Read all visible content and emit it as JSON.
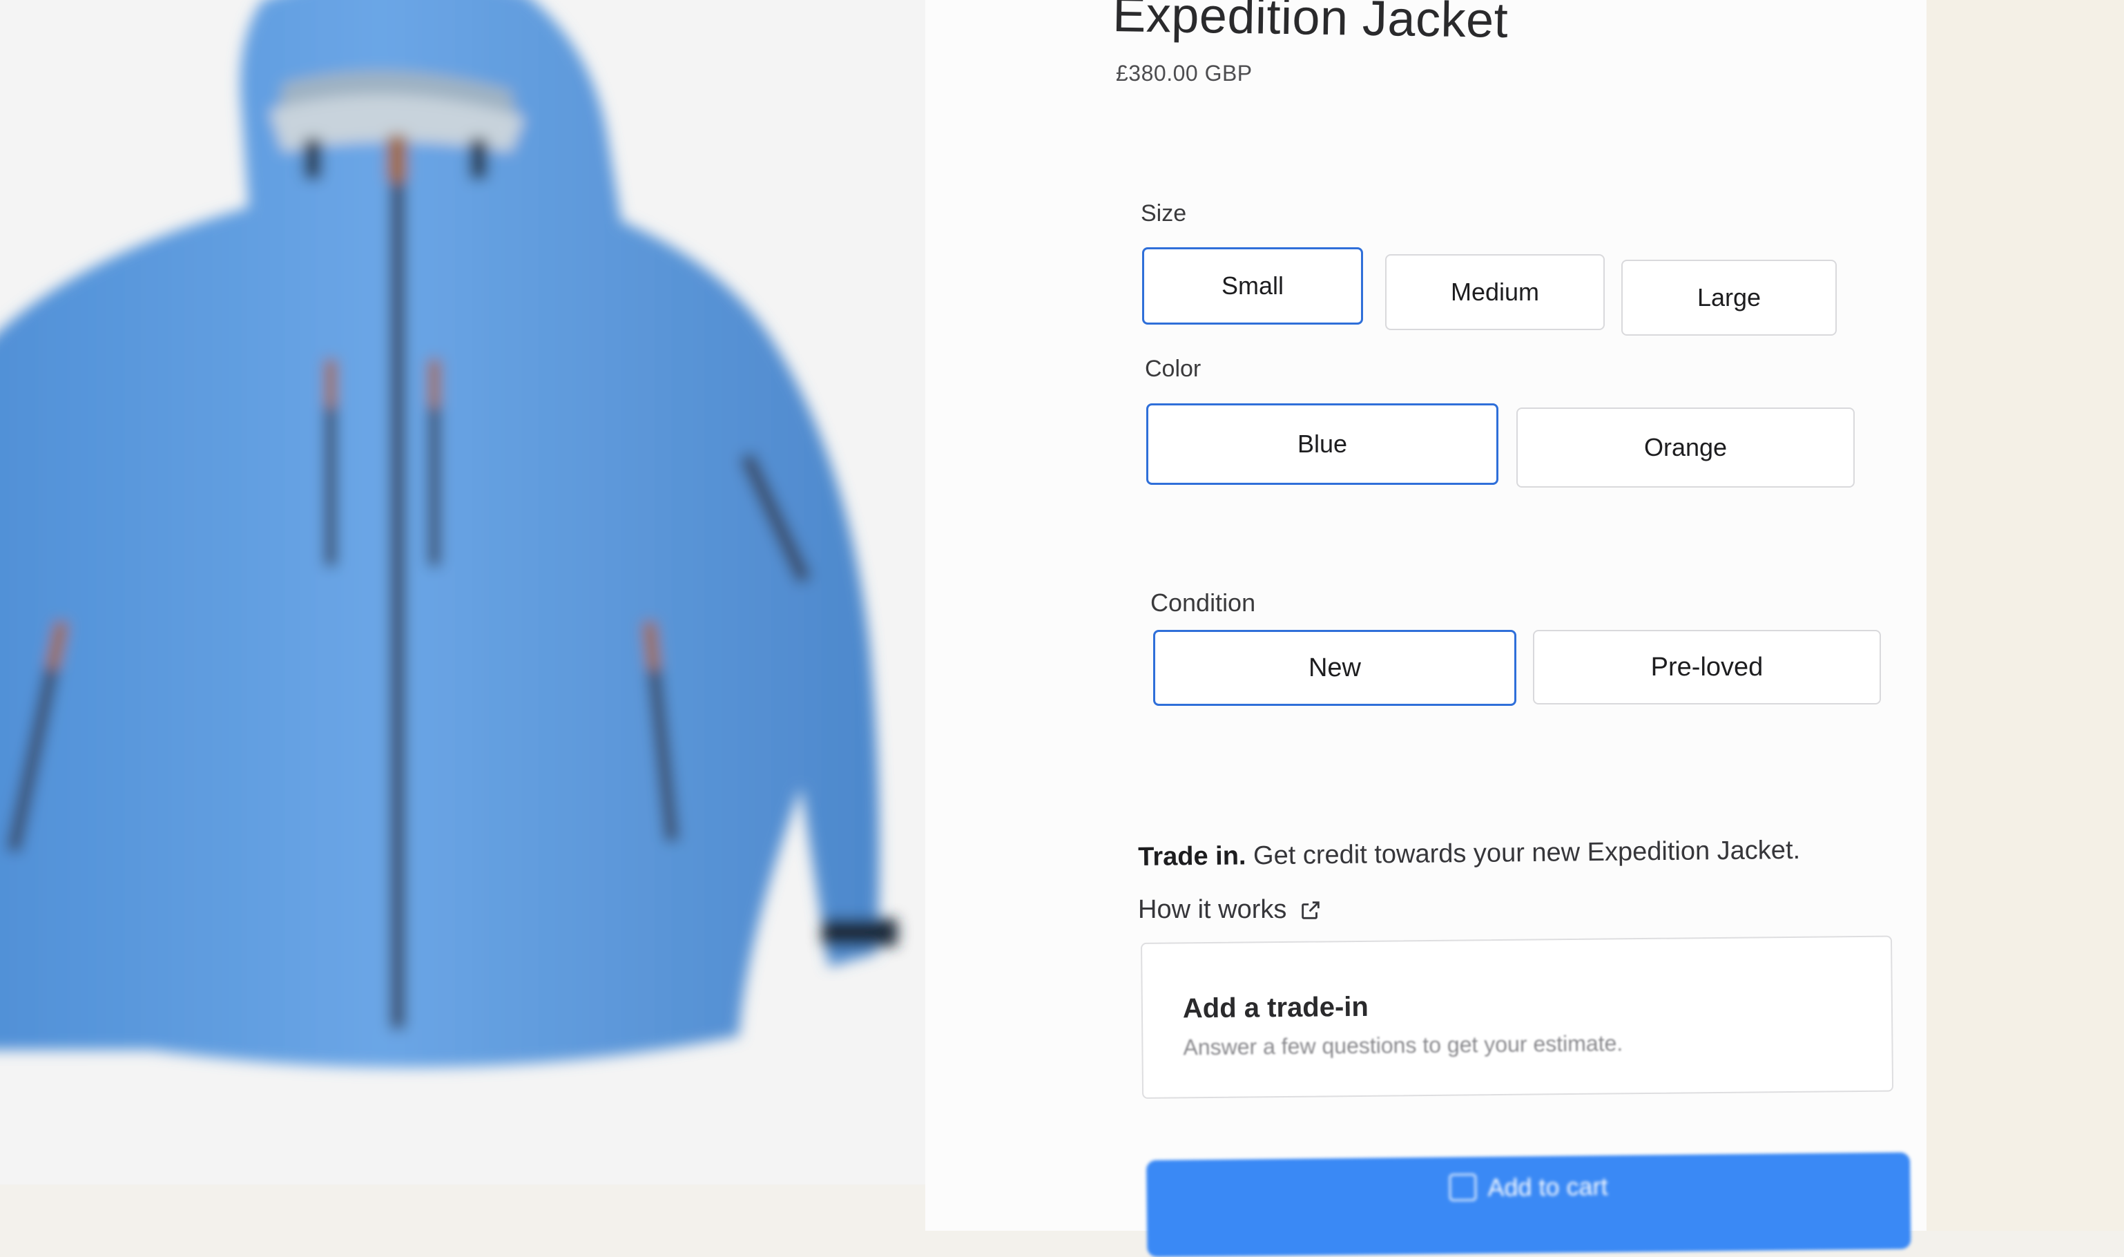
{
  "product": {
    "title": "Expedition Jacket",
    "price": "£380.00 GBP",
    "image_alt": "Blue insulated hooded jacket"
  },
  "size": {
    "label": "Size",
    "options": [
      "Small",
      "Medium",
      "Large"
    ],
    "selected": "Small"
  },
  "color": {
    "label": "Color",
    "options": [
      "Blue",
      "Orange"
    ],
    "selected": "Blue"
  },
  "condition": {
    "label": "Condition",
    "options": [
      "New",
      "Pre-loved"
    ],
    "selected": "New"
  },
  "trade_in": {
    "lead": "Trade in.",
    "text": "Get credit towards your new Expedition Jacket.",
    "link": "How it works",
    "card_title": "Add a trade-in",
    "card_subtitle": "Answer a few questions to get your estimate."
  },
  "cart": {
    "button_label": "Add to cart"
  },
  "colors": {
    "accent": "#2f6fd9",
    "cta": "#3a89f5",
    "jacket": "#5f9ee0"
  },
  "icons": {
    "external_link": "external-link-icon",
    "bag": "shopping-bag-icon"
  }
}
